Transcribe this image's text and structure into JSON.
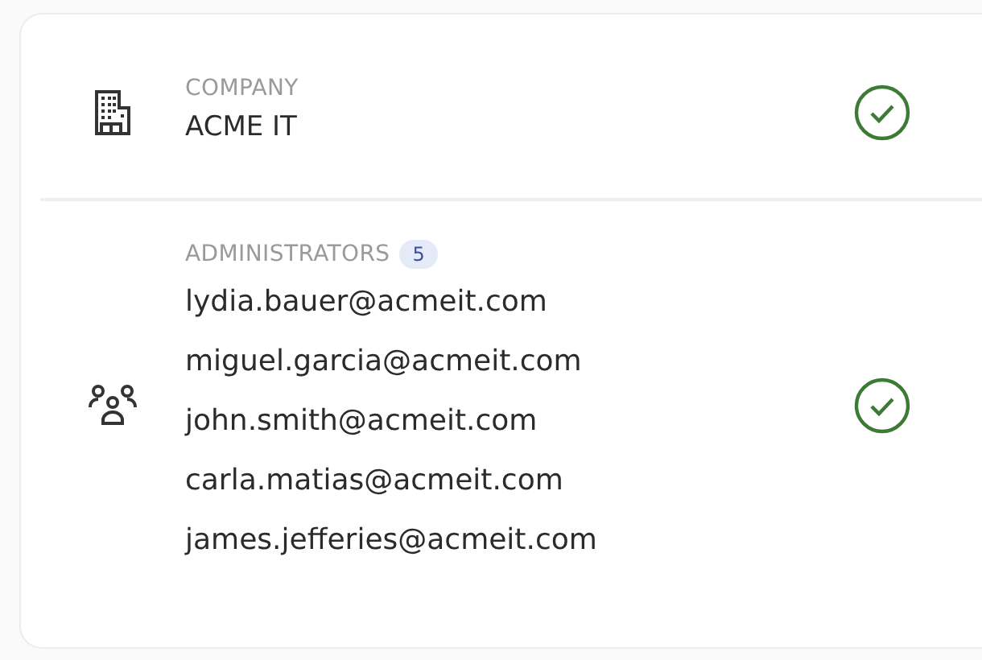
{
  "sections": [
    {
      "kind": "company",
      "label": "COMPANY",
      "values": [
        "ACME IT"
      ],
      "verified": true
    },
    {
      "kind": "administrators",
      "label": "ADMINISTRATORS",
      "count": "5",
      "values": [
        "lydia.bauer@acmeit.com",
        "miguel.garcia@acmeit.com",
        "john.smith@acmeit.com",
        "carla.matias@acmeit.com",
        "james.jefferies@acmeit.com"
      ],
      "verified": true
    }
  ]
}
